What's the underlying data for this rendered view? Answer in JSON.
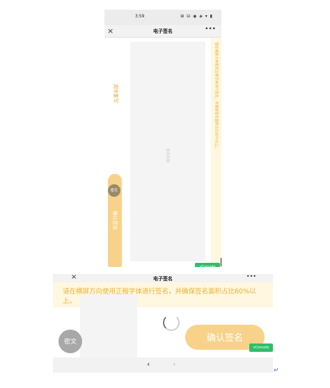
{
  "portrait": {
    "status_time": "3:59",
    "status_icons": "⊞ ⊟ ◉ ◈ ▾ ▮",
    "nav_title": "电子签名",
    "close_glyph": "×",
    "more_glyph": "•••",
    "clear_label": "清除重写",
    "pad_hint": "签名区域",
    "tip_text": "请在横屏方向使用正楷字体进行签名，并确保签名面积占比60%以上。",
    "confirm_label": "确认签名",
    "secret_label": "密文",
    "vconsole_label": "vConsole"
  },
  "landscape": {
    "nav_title": "电子签名",
    "close_glyph": "×",
    "more_glyph": "•••",
    "tip_text": "请在横屏方向使用正楷字体进行签名，并确保签名面积占比60%以上。",
    "secret_label": "密文",
    "confirm_label": "确认签名",
    "vconsole_label": "vConsole",
    "back_glyph": "‹",
    "forward_glyph": "›"
  },
  "return_glyph": "↵",
  "colors": {
    "accent": "#e9b23a",
    "confirm_bg": "#f8d28a",
    "tip_bg": "#fff7df",
    "vconsole": "#2fbe6a"
  }
}
